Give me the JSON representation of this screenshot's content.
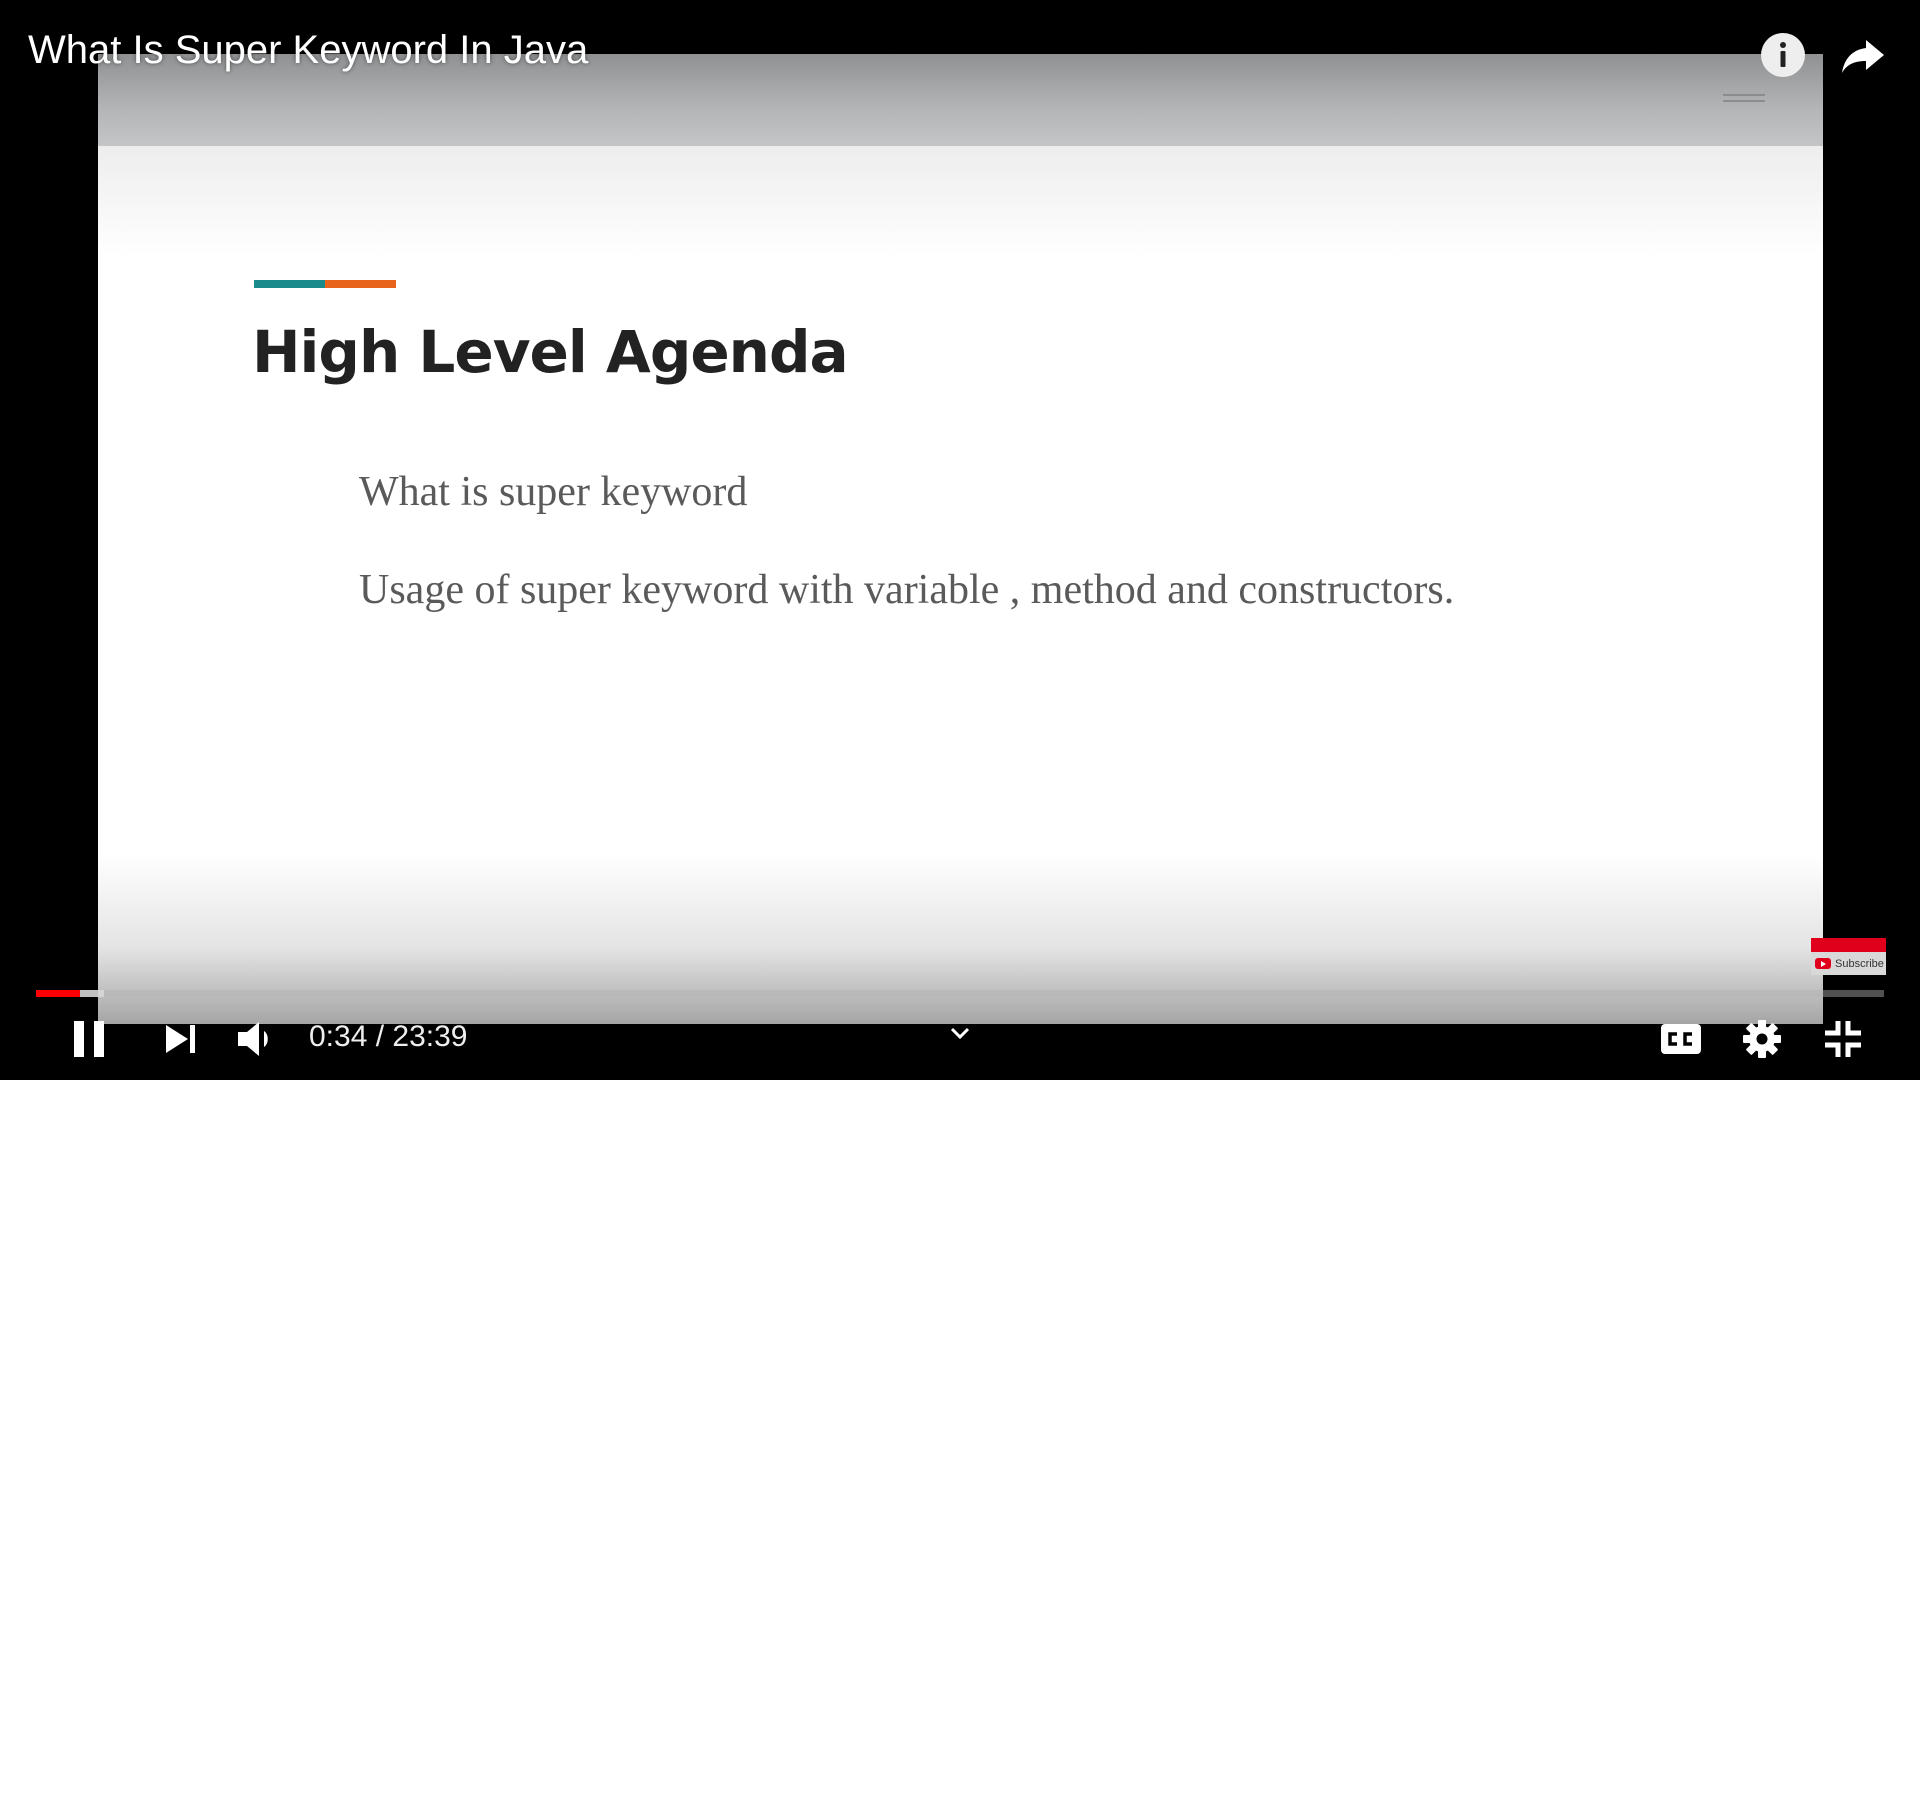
{
  "video": {
    "title": "What Is Super Keyword In Java"
  },
  "slide": {
    "title": "High Level Agenda",
    "items": [
      "What is super keyword",
      "Usage of super keyword with variable , method and constructors."
    ],
    "accent_colors": {
      "teal": "#1a8a8a",
      "orange": "#e8641c"
    }
  },
  "player": {
    "time": "0:34 / 23:39",
    "progress_fraction": 0.024,
    "buffer_fraction": 0.037,
    "played_color": "#ff0000",
    "watermark_label": "Subscribe",
    "icons": {
      "info": "info-icon",
      "share": "share-icon",
      "pause": "pause-icon",
      "next": "next-icon",
      "volume": "volume-icon",
      "chevron": "chevron-down-icon",
      "captions": "captions-icon",
      "settings": "gear-icon",
      "exit_fullscreen": "exit-fullscreen-icon"
    }
  }
}
